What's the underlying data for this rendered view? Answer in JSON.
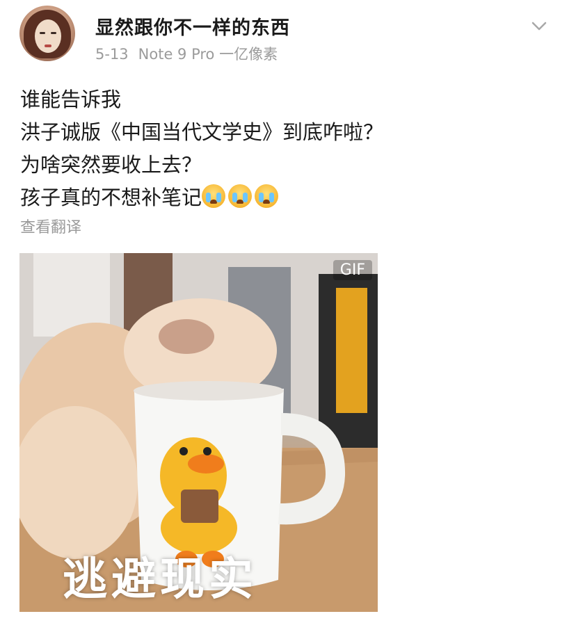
{
  "post": {
    "username": "显然跟你不一样的东西",
    "date": "5-13",
    "device": "Note 9 Pro 一亿像素",
    "lines": [
      "谁能告诉我",
      "洪子诚版《中国当代文学史》到底咋啦？",
      "为啥突然要收上去？",
      "孩子真的不想补笔记"
    ],
    "emoji_count": 3,
    "emoji_icon": "crying-face-emoji",
    "translate_link": "查看翻译"
  },
  "media": {
    "badge": "GIF",
    "caption": "逃避现实"
  }
}
